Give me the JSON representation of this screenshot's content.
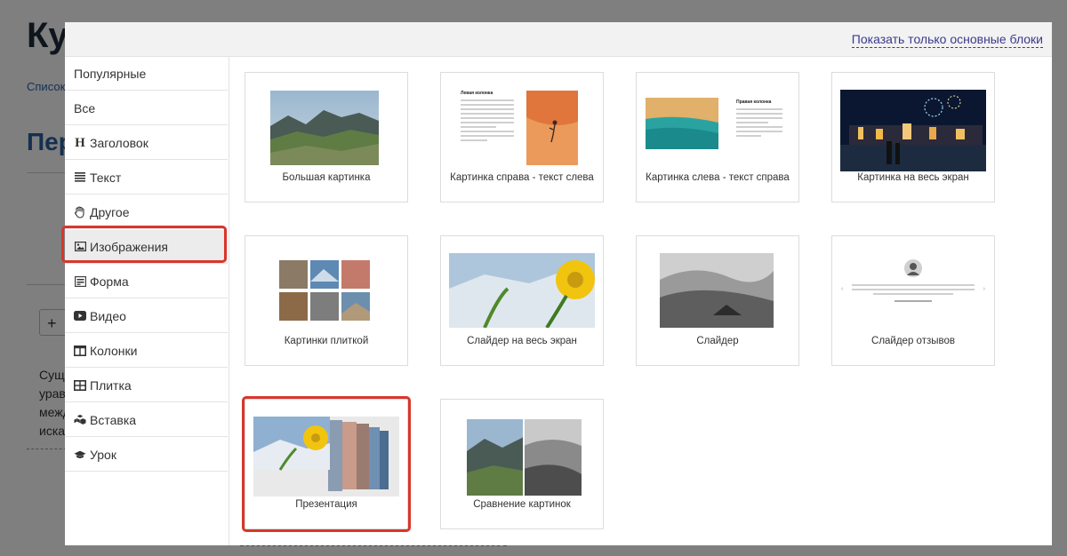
{
  "background": {
    "title_partial": "Ку",
    "breadcrumb_partial": "Список",
    "heading_partial": "Пер",
    "text_lines": [
      "Сущ",
      "урав",
      "межд",
      "иска"
    ]
  },
  "modal": {
    "show_basic_link": "Показать только основные блоки",
    "sidebar": [
      {
        "label": "Популярные",
        "icon": ""
      },
      {
        "label": "Все",
        "icon": ""
      },
      {
        "label": "Заголовок",
        "icon": "heading-icon"
      },
      {
        "label": "Текст",
        "icon": "text-lines-icon"
      },
      {
        "label": "Другое",
        "icon": "hand-icon"
      },
      {
        "label": "Изображения",
        "icon": "image-icon",
        "active": true
      },
      {
        "label": "Форма",
        "icon": "form-icon"
      },
      {
        "label": "Видео",
        "icon": "video-play-icon"
      },
      {
        "label": "Колонки",
        "icon": "columns-icon"
      },
      {
        "label": "Плитка",
        "icon": "grid-icon"
      },
      {
        "label": "Вставка",
        "icon": "cubes-icon"
      },
      {
        "label": "Урок",
        "icon": "graduation-cap-icon"
      }
    ],
    "blocks": [
      {
        "label": "Большая картинка"
      },
      {
        "label": "Картинка справа - текст слева",
        "text_title": "Левая колонка"
      },
      {
        "label": "Картинка слева - текст справа",
        "text_title": "Правая колонка"
      },
      {
        "label": "Картинка на весь экран"
      },
      {
        "label": "Картинки плиткой"
      },
      {
        "label": "Слайдер на весь экран"
      },
      {
        "label": "Слайдер"
      },
      {
        "label": "Слайдер отзывов"
      },
      {
        "label": "Презентация",
        "highlighted": true
      },
      {
        "label": "Сравнение картинок"
      }
    ]
  }
}
